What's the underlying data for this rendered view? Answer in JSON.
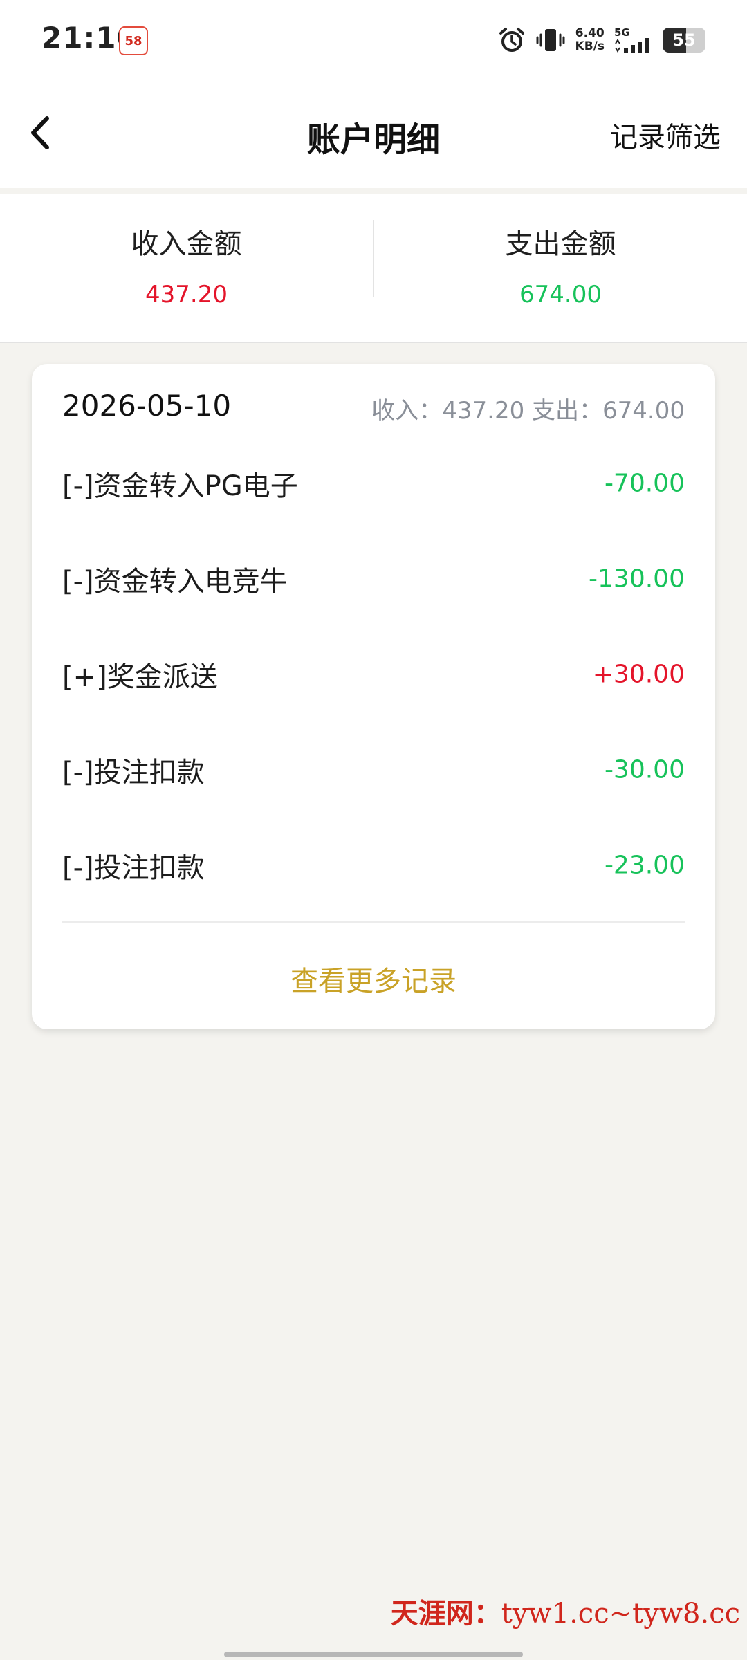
{
  "status_bar": {
    "time": "21:10",
    "app_badge": "58",
    "net_speed_value": "6.40",
    "net_speed_unit": "KB/s",
    "network_type": "5G",
    "battery_level": "55",
    "battery_fraction": 0.55
  },
  "header": {
    "title": "账户明细",
    "filter_label": "记录筛选"
  },
  "summary": {
    "income_label": "收入金额",
    "income_value": "437.20",
    "expense_label": "支出金额",
    "expense_value": "674.00"
  },
  "colors": {
    "income": "#e4142a",
    "expense": "#17c25a",
    "link": "#c9a227"
  },
  "card": {
    "date": "2026-05-10",
    "day_summary": "收入：437.20 支出：674.00",
    "records": [
      {
        "title": "[-]资金转入PG电子",
        "amount": "-70.00",
        "type": "expense"
      },
      {
        "title": "[-]资金转入电竞牛",
        "amount": "-130.00",
        "type": "expense"
      },
      {
        "title": "[+]奖金派送",
        "amount": "+30.00",
        "type": "income"
      },
      {
        "title": "[-]投注扣款",
        "amount": "-30.00",
        "type": "expense"
      },
      {
        "title": "[-]投注扣款",
        "amount": "-23.00",
        "type": "expense"
      }
    ],
    "view_more_label": "查看更多记录"
  },
  "watermark": {
    "name": "天涯网：",
    "domains": "tyw1.cc~tyw8.cc"
  }
}
